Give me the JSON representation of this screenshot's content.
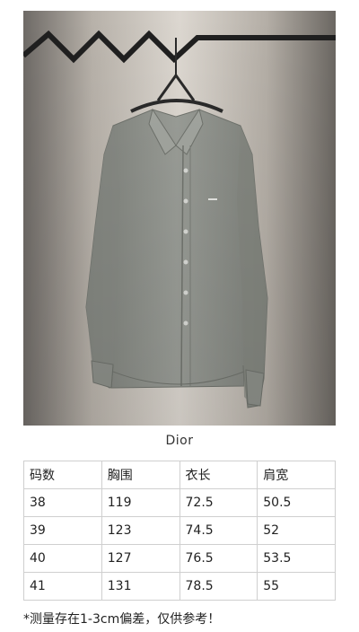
{
  "product": {
    "brand": "Dior",
    "image_icon": "shirt-on-hanger-photo"
  },
  "size_table": {
    "headers": [
      "码数",
      "胸围",
      "衣长",
      "肩宽"
    ],
    "rows": [
      [
        "38",
        "119",
        "72.5",
        "50.5"
      ],
      [
        "39",
        "123",
        "74.5",
        "52"
      ],
      [
        "40",
        "127",
        "76.5",
        "53.5"
      ],
      [
        "41",
        "131",
        "78.5",
        "55"
      ]
    ]
  },
  "note": "*测量存在1-3cm偏差，仅供参考！",
  "colors": {
    "shirt": "#8f928c",
    "background_wall": "#cfc9c1",
    "table_border": "#cfcfcf"
  }
}
